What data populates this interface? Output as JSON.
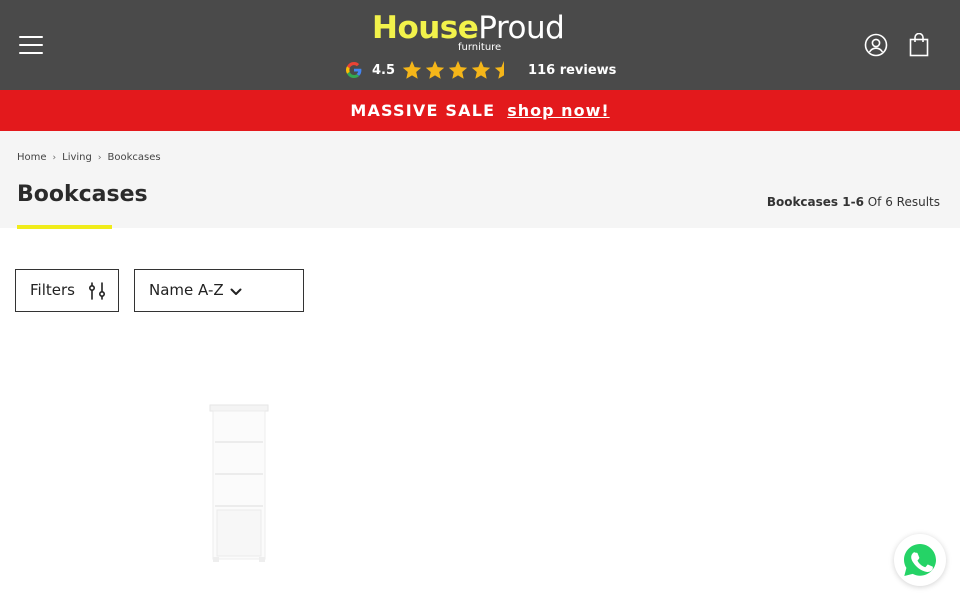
{
  "header": {
    "logo": {
      "house": "House",
      "proud": "Proud",
      "sub": "furniture"
    },
    "rating": {
      "value": "4.5",
      "stars": 4.5,
      "reviews": "116 reviews"
    },
    "icons": {
      "menu": "hamburger-menu-icon",
      "account": "account-icon",
      "cart": "shopping-bag-icon"
    }
  },
  "banner": {
    "text": "MASSIVE SALE",
    "link": "shop now!"
  },
  "breadcrumb": {
    "items": [
      "Home",
      "Living",
      "Bookcases"
    ]
  },
  "page": {
    "title": "Bookcases",
    "results_bold": "Bookcases 1-6",
    "results_rest": " Of 6 Results"
  },
  "toolbar": {
    "filters_label": "Filters",
    "sort_value": "Name A-Z"
  },
  "colors": {
    "header_bg": "#4a4a4a",
    "banner_bg": "#e3191c",
    "accent_yellow": "#f0ec1a",
    "star": "#f5b619",
    "whatsapp": "#25d366"
  }
}
